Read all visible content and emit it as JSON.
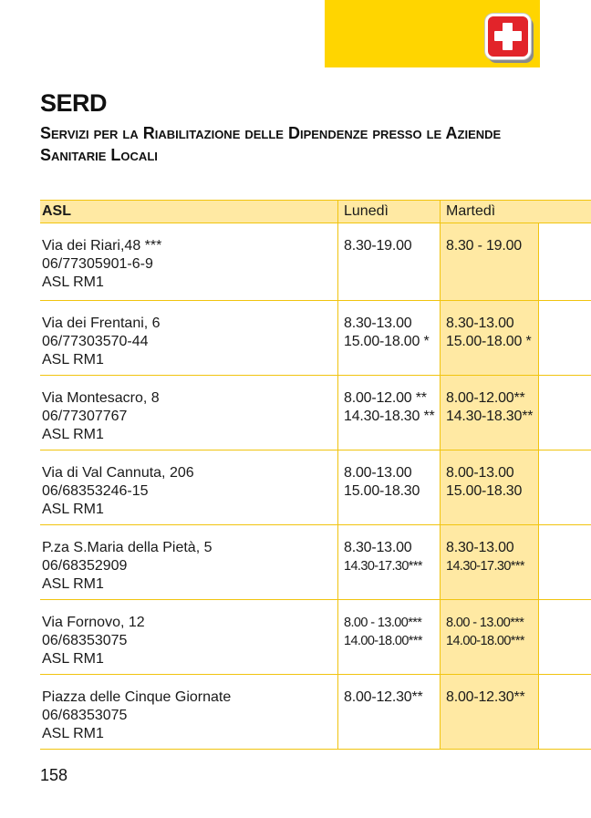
{
  "header": {
    "title": "SERD",
    "subtitle": "Servizi per la Riabilitazione delle Dipendenze presso le Aziende Sanitarie Locali",
    "icon": "first-aid-kit-icon"
  },
  "colors": {
    "accent": "#ffd500",
    "table_tint": "#ffe9a3",
    "rule": "#f1c40f",
    "icon_red": "#e2242a"
  },
  "table": {
    "columns": {
      "asl": "ASL",
      "monday": "Lunedì",
      "tuesday": "Martedì"
    },
    "rows": [
      {
        "address": "Via dei Riari,48 ***",
        "phone": "06/77305901-6-9",
        "asl": "ASL RM1",
        "mon": [
          "8.30-19.00"
        ],
        "tue": [
          "8.30 - 19.00"
        ]
      },
      {
        "address": "Via dei Frentani, 6",
        "phone": "06/77303570-44",
        "asl": "ASL RM1",
        "mon": [
          "8.30-13.00",
          "15.00-18.00 *"
        ],
        "tue": [
          "8.30-13.00",
          "15.00-18.00 *"
        ]
      },
      {
        "address": "Via Montesacro, 8",
        "phone": "06/77307767",
        "asl": "ASL RM1",
        "mon": [
          "8.00-12.00 **",
          "14.30-18.30 **"
        ],
        "tue": [
          "8.00-12.00**",
          "14.30-18.30**"
        ]
      },
      {
        "address": "Via di Val Cannuta, 206",
        "phone": "06/68353246-15",
        "asl": "ASL RM1",
        "mon": [
          "8.00-13.00",
          "15.00-18.30"
        ],
        "tue": [
          "8.00-13.00",
          "15.00-18.30"
        ]
      },
      {
        "address": "P.za S.Maria della Pietà, 5",
        "phone": "06/68352909",
        "asl": "ASL RM1",
        "mon": [
          "8.30-13.00",
          "14.30-17.30***"
        ],
        "tue": [
          "8.30-13.00",
          "14.30-17.30***"
        ]
      },
      {
        "address": "Via Fornovo, 12",
        "phone": "06/68353075",
        "asl": "ASL RM1",
        "mon": [
          "8.00 - 13.00***",
          "14.00-18.00***"
        ],
        "tue": [
          "8.00 - 13.00***",
          "14.00-18.00***"
        ]
      },
      {
        "address": "Piazza delle Cinque Giornate",
        "phone": "06/68353075",
        "asl": "ASL RM1",
        "mon": [
          "8.00-12.30**"
        ],
        "tue": [
          "8.00-12.30**"
        ]
      }
    ]
  },
  "footer": {
    "page_number": "158"
  }
}
